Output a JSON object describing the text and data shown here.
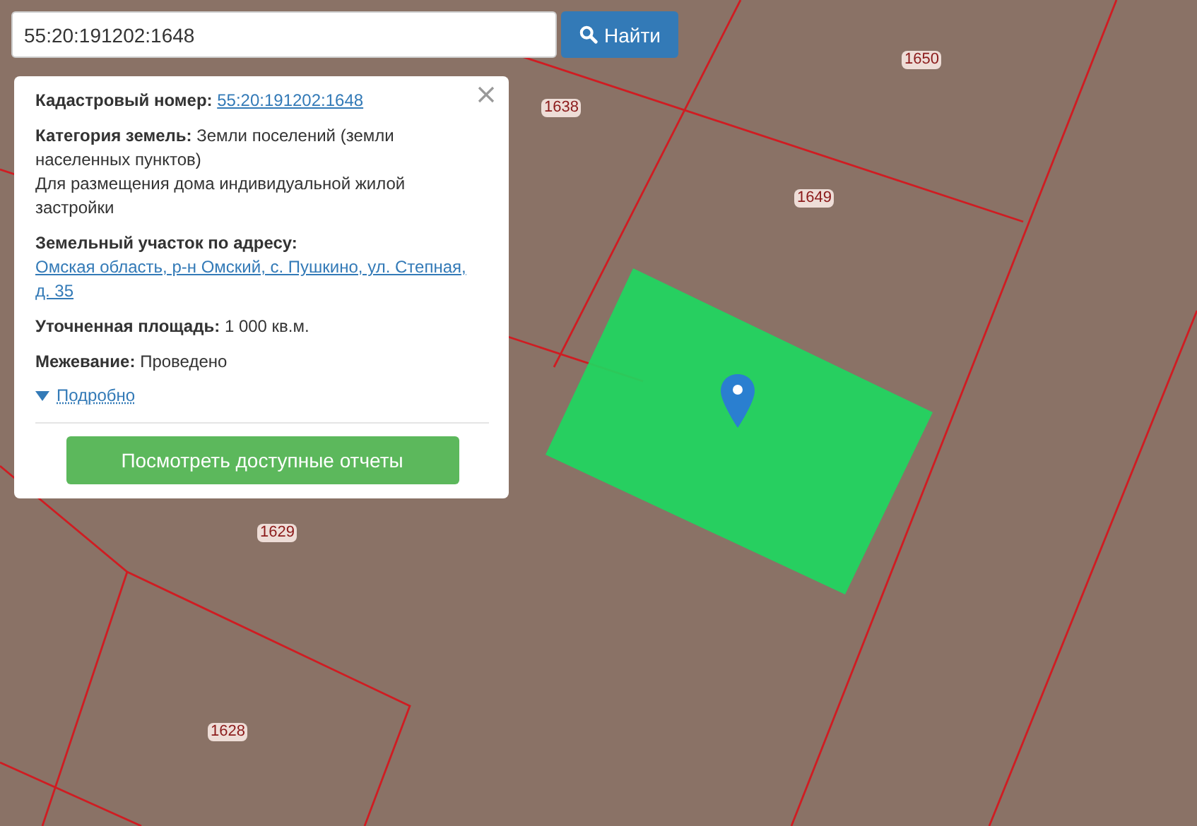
{
  "search": {
    "value": "55:20:191202:1648",
    "button": "Найти"
  },
  "info_panel": {
    "rows": [
      {
        "label": "Кадастровый номер:",
        "value": "55:20:191202:1648",
        "kind": "link"
      },
      {
        "label": "Категория земель:",
        "value": "Земли поселений (земли населенных пунктов)",
        "kind": "text",
        "note": "Для размещения дома индивидуальной жилой застройки"
      },
      {
        "label": "Земельный участок по адресу:",
        "value": "Омская область, р-н Омский, с. Пушкино, ул. Степная, д. 35",
        "kind": "link"
      },
      {
        "label": "Уточненная площадь:",
        "value": "1 000 кв.м.",
        "kind": "text"
      },
      {
        "label": "Межевание:",
        "value": "Проведено",
        "kind": "text"
      }
    ],
    "details_link": "Подробно",
    "expanded": false,
    "reports_button": "Посмотреть доступные отчеты"
  },
  "parcel_labels": [
    "1650",
    "1638",
    "1649",
    "1629",
    "1628"
  ]
}
